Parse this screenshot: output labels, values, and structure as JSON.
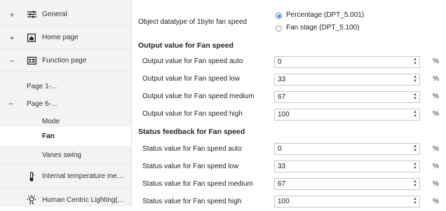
{
  "sidebar": {
    "items": [
      {
        "expander": "+",
        "icon": "sliders-icon",
        "label": "General"
      },
      {
        "expander": "+",
        "icon": "home-icon",
        "label": "Home page"
      },
      {
        "expander": "−",
        "icon": "function-icon",
        "label": "Function page"
      }
    ],
    "page1": "Page 1-...",
    "page6_expander": "−",
    "page6": "Page 6-...",
    "sub_items": [
      "Mode",
      "Fan",
      "Vanes swing"
    ],
    "bottom_items": [
      {
        "icon": "thermometer-icon",
        "label": "Internal temperature meas..."
      },
      {
        "icon": "light-icon",
        "label": "Human Centric Lighting(H..."
      }
    ]
  },
  "datatype": {
    "label": "Object datatype of 1byte fan speed",
    "options": [
      "Percentage (DPT_5.001)",
      "Fan stage (DPT_5.100)"
    ],
    "selected_index": 0
  },
  "output": {
    "title": "Output value for Fan speed",
    "rows": [
      {
        "label": "Output value for Fan speed auto",
        "value": "0"
      },
      {
        "label": "Output value for Fan speed low",
        "value": "33"
      },
      {
        "label": "Output value for Fan speed medium",
        "value": "67"
      },
      {
        "label": "Output value for Fan speed high",
        "value": "100"
      }
    ]
  },
  "status": {
    "title": "Status feedback for Fan speed",
    "rows": [
      {
        "label": "Status value for Fan speed auto",
        "value": "0"
      },
      {
        "label": "Status value for Fan speed low",
        "value": "33"
      },
      {
        "label": "Status value for Fan speed medium",
        "value": "67"
      },
      {
        "label": "Status value for Fan speed high",
        "value": "100"
      }
    ]
  },
  "unit": "%",
  "spinner": {
    "up": "▲",
    "down": "▼"
  }
}
